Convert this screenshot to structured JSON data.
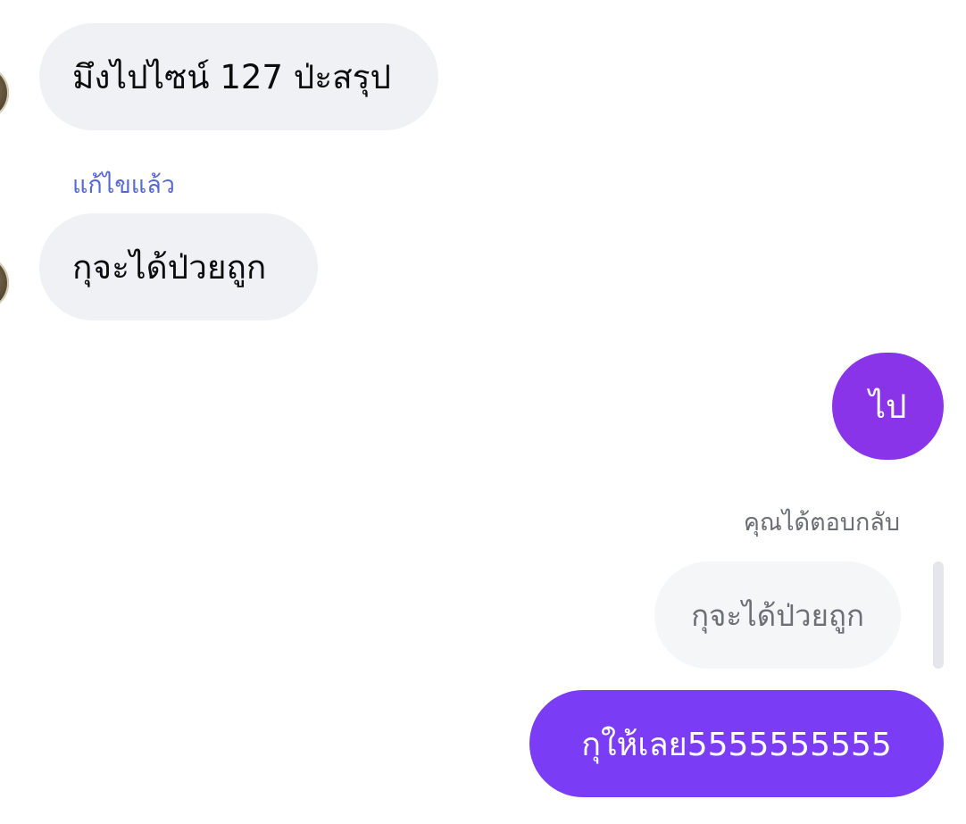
{
  "messages": {
    "incoming": [
      {
        "text": "มึงไปไซน์ 127 ป่ะสรุป"
      },
      {
        "text": "กุจะได้ป่วยถูก",
        "edited_label": "แก้ไขแล้ว"
      }
    ],
    "outgoing": [
      {
        "text": "ไป",
        "color": "#8a34ea"
      },
      {
        "text": "กุให้เลย5555555555",
        "color": "#7a3cf4"
      }
    ],
    "reply": {
      "label": "คุณได้ตอบกลับ",
      "quoted_text": "กุจะได้ป่วยถูก"
    }
  },
  "colors": {
    "incoming_bubble": "#eff1f4",
    "edited_label": "#5468d6",
    "reply_label": "#6a6d73",
    "quote_bubble": "#f5f6f8"
  }
}
